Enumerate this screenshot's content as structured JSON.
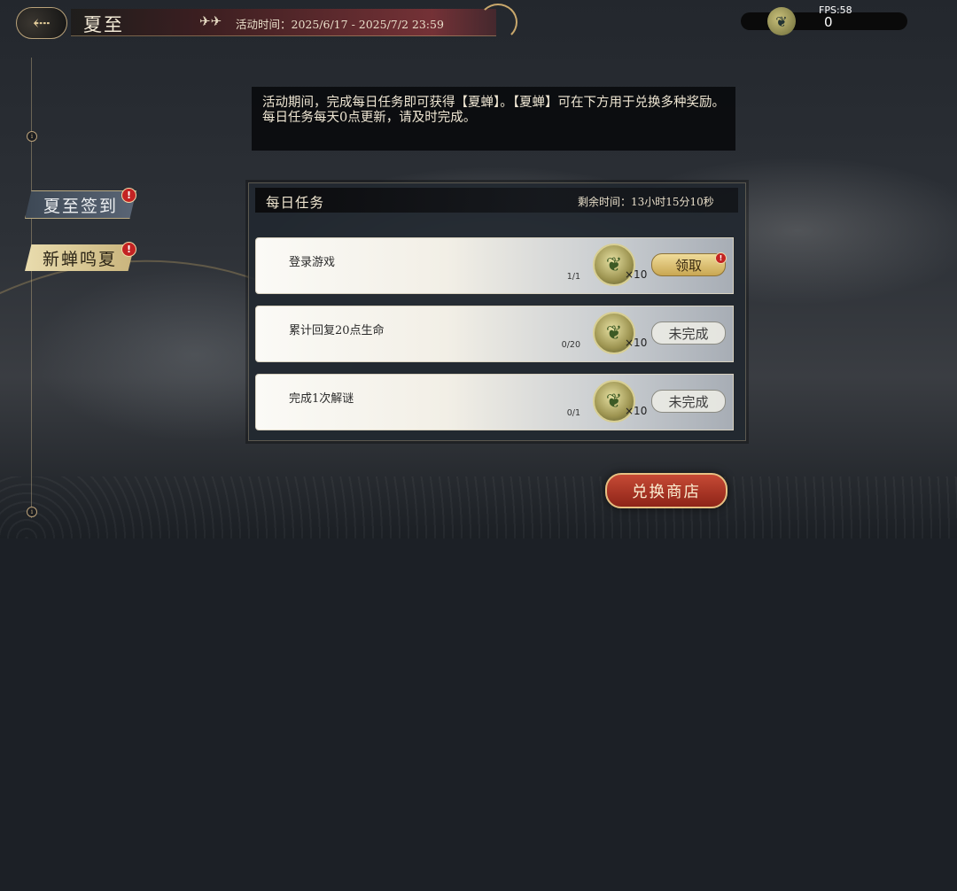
{
  "header": {
    "back_icon": "back-arrow-icon",
    "title": "夏至",
    "deco_icon": "double-arrow-icon",
    "event_time": "活动时间：2025/6/17 - 2025/7/2 23:59"
  },
  "currency": {
    "icon": "cicada-token-icon",
    "value": "0",
    "fps": "FPS:58"
  },
  "sidebar": {
    "items": [
      {
        "label": "夏至签到",
        "active": false,
        "badge": "!"
      },
      {
        "label": "新蝉鸣夏",
        "active": true,
        "badge": "!"
      }
    ]
  },
  "description": {
    "line1": "活动期间，完成每日任务即可获得【夏蝉】。【夏蝉】可在下方用于兑换多种奖励。",
    "line2": "每日任务每天0点更新，请及时完成。"
  },
  "daily": {
    "title": "每日任务",
    "remaining": "剩余时间：13小时15分10秒"
  },
  "tasks": [
    {
      "name": "登录游戏",
      "progress": "1/1",
      "reward_qty": "×10",
      "button": "领取",
      "state": "claimable",
      "badge": "!"
    },
    {
      "name": "累计回复20点生命",
      "progress": "0/20",
      "reward_qty": "×10",
      "button": "未完成",
      "state": "incomplete"
    },
    {
      "name": "完成1次解谜",
      "progress": "0/1",
      "reward_qty": "×10",
      "button": "未完成",
      "state": "incomplete"
    }
  ],
  "shop": {
    "label": "兑换商店"
  },
  "colors": {
    "accent_gold": "#c9a752",
    "shop_red": "#b03b28",
    "badge_red": "#c32323"
  }
}
